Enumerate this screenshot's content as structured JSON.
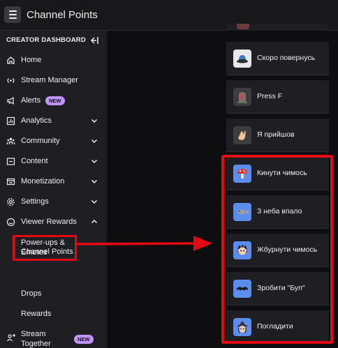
{
  "header": {
    "title": "Channel Points"
  },
  "sidebar": {
    "section_title": "CREATOR DASHBOARD",
    "items": [
      {
        "label": "Home",
        "icon": "home-icon"
      },
      {
        "label": "Stream Manager",
        "icon": "broadcast-icon"
      },
      {
        "label": "Alerts",
        "icon": "megaphone-icon",
        "badge": "NEW"
      },
      {
        "label": "Analytics",
        "icon": "analytics-icon"
      },
      {
        "label": "Community",
        "icon": "community-icon"
      },
      {
        "label": "Content",
        "icon": "content-icon"
      },
      {
        "label": "Monetization",
        "icon": "monetization-icon"
      },
      {
        "label": "Settings",
        "icon": "gear-icon"
      },
      {
        "label": "Viewer Rewards",
        "icon": "smiley-icon"
      }
    ],
    "sub_items": [
      {
        "label_line1": "Power-ups &",
        "label_line2": "Channel Points"
      },
      {
        "label": "Emotes"
      },
      {
        "label": "Drops"
      },
      {
        "label": "Rewards"
      }
    ],
    "stream_together": {
      "label_line1": "Stream",
      "label_line2": "Together",
      "badge": "NEW",
      "icon": "add-person-icon"
    }
  },
  "rewards": [
    {
      "label": "Скоро повернусь",
      "icon": "hat-icon",
      "bg": "#e8e8e8"
    },
    {
      "label": "Press F",
      "icon": "gravestone-icon",
      "bg": "#3d3d40"
    },
    {
      "label": "Я прийшов",
      "icon": "wave-hand-icon",
      "bg": "#3d3d40"
    },
    {
      "label": "Кинути чимось",
      "icon": "mushroom-icon",
      "bg": "#5b8def"
    },
    {
      "label": "З неба впало",
      "icon": "fish-icon",
      "bg": "#5b8def"
    },
    {
      "label": "Жбурнути чимось",
      "icon": "character-icon",
      "bg": "#5b8def"
    },
    {
      "label": "Зробити \"Буп\"",
      "icon": "mustache-icon",
      "bg": "#5b8def"
    },
    {
      "label": "Погладити",
      "icon": "witch-icon",
      "bg": "#5b8def"
    }
  ],
  "colors": {
    "highlight": "#e50914",
    "badge": "#bf94ff",
    "sidebar_bg": "#1f1f23",
    "reward_icon_bg": "#5b8def"
  }
}
